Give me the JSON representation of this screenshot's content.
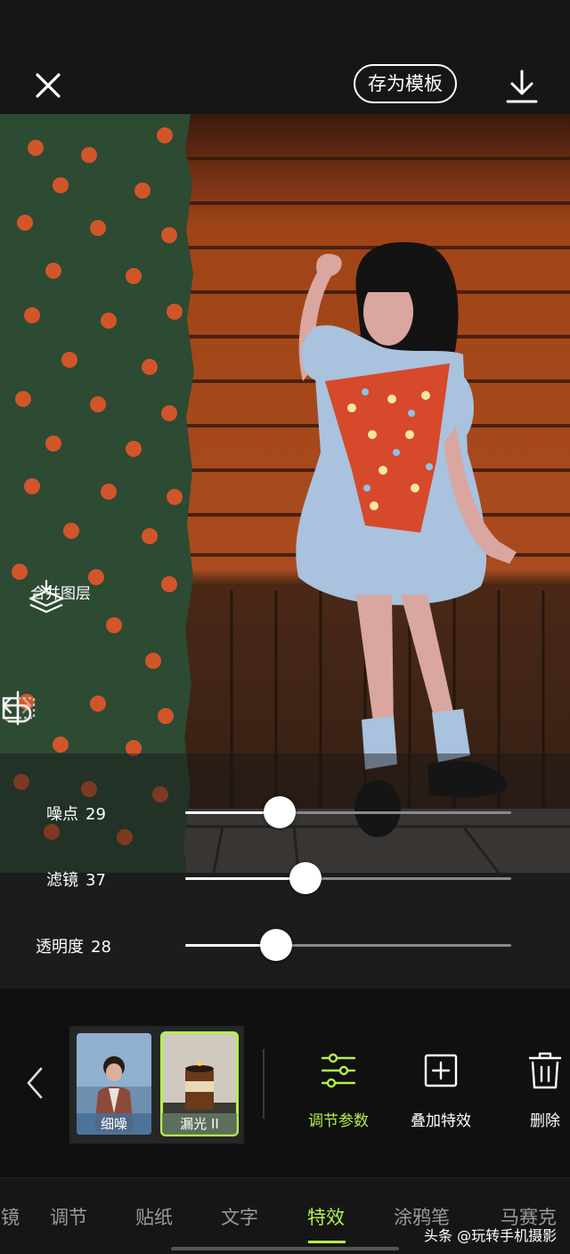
{
  "header": {
    "save_template_label": "存为模板"
  },
  "canvas_tools": {
    "merge_layers_label": "合并图层"
  },
  "sliders": [
    {
      "label": "噪点",
      "value": 29,
      "fill": 0.29
    },
    {
      "label": "滤镜",
      "value": 37,
      "fill": 0.37
    },
    {
      "label": "透明度",
      "value": 28,
      "fill": 0.28
    }
  ],
  "effects": {
    "thumbnails": [
      {
        "label": "细噪",
        "selected": false
      },
      {
        "label": "漏光 II",
        "selected": true
      }
    ],
    "tools": [
      {
        "label": "调节参数",
        "icon": "sliders-icon",
        "active": true
      },
      {
        "label": "叠加特效",
        "icon": "add-square-icon",
        "active": false
      },
      {
        "label": "删除",
        "icon": "trash-icon",
        "active": false
      }
    ]
  },
  "tabs": [
    {
      "label": "滤镜",
      "active": false
    },
    {
      "label": "调节",
      "active": false
    },
    {
      "label": "贴纸",
      "active": false
    },
    {
      "label": "文字",
      "active": false
    },
    {
      "label": "特效",
      "active": true
    },
    {
      "label": "涂鸦笔",
      "active": false
    },
    {
      "label": "马赛克",
      "active": false
    }
  ],
  "watermark": "头条 @玩转手机摄影",
  "colors": {
    "accent": "#b3f04a",
    "background": "#161616",
    "green_panel": "#2d4a33",
    "flower": "#d2552a"
  }
}
